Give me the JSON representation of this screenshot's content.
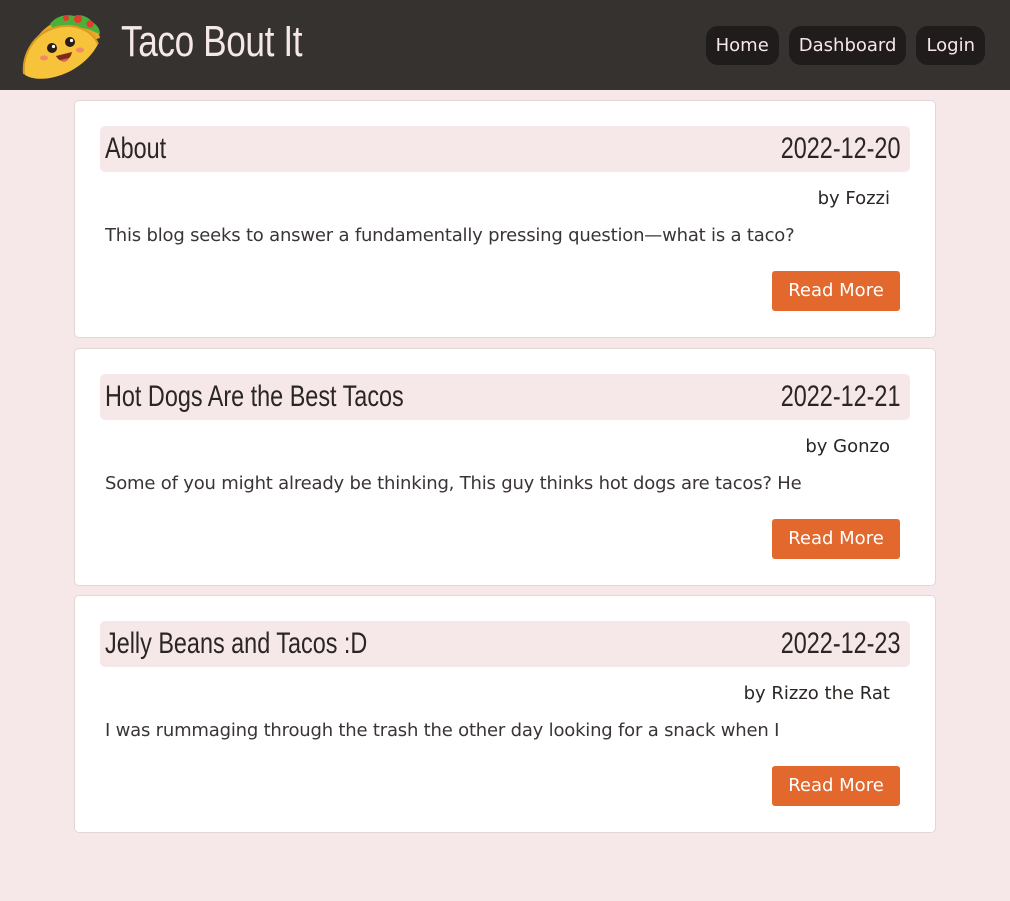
{
  "header": {
    "site_title": "Taco Bout It",
    "logo_icon": "taco-icon",
    "nav": [
      "Home",
      "Dashboard",
      "Login"
    ]
  },
  "posts": [
    {
      "title": "About",
      "date": "2022-12-20",
      "author": "by Fozzi",
      "excerpt": "This blog seeks to answer a fundamentally pressing question—what is a taco?",
      "read_more": "Read More"
    },
    {
      "title": "Hot Dogs Are the Best Tacos",
      "date": "2022-12-21",
      "author": "by Gonzo",
      "excerpt": "Some of you might already be thinking, This guy thinks hot dogs are tacos? He",
      "read_more": "Read More"
    },
    {
      "title": "Jelly Beans and Tacos :D",
      "date": "2022-12-23",
      "author": "by Rizzo the Rat",
      "excerpt": "I was rummaging through the trash the other day looking for a snack when I",
      "read_more": "Read More"
    }
  ],
  "colors": {
    "header_bg": "#363230",
    "page_bg": "#f6e8e8",
    "accent": "#e2682d",
    "nav_button_bg": "#1f1c1b"
  }
}
